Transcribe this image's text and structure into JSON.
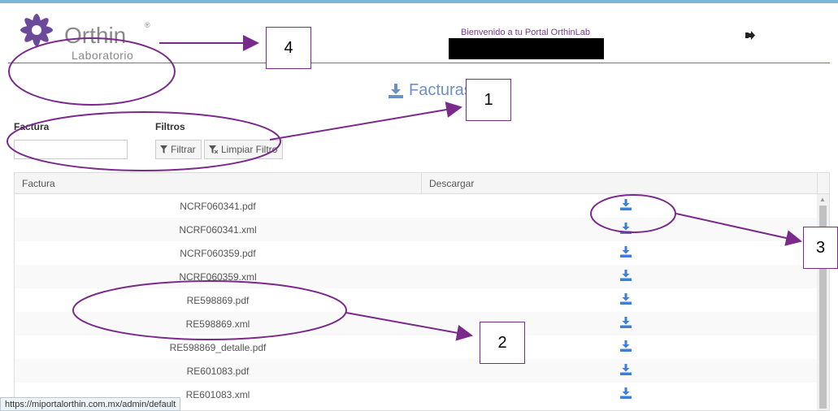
{
  "header": {
    "welcome_text": "Bienvenido a tu Portal OrthinLab",
    "logout_icon": "sign-out-icon",
    "logo_text": "Orthin",
    "logo_subtext": "Laboratorio",
    "logo_reg": "®"
  },
  "page": {
    "title": "Facturas",
    "title_icon": "download-icon"
  },
  "filters": {
    "factura_label": "Factura",
    "filtros_label": "Filtros",
    "factura_value": "",
    "filter_button": "Filtrar",
    "clear_button": "Limpiar Filtro"
  },
  "table": {
    "columns": [
      "Factura",
      "Descargar"
    ],
    "rows": [
      {
        "file": "NCRF060341.pdf"
      },
      {
        "file": "NCRF060341.xml"
      },
      {
        "file": "NCRF060359.pdf"
      },
      {
        "file": "NCRF060359.xml"
      },
      {
        "file": "RE598869.pdf"
      },
      {
        "file": "RE598869.xml"
      },
      {
        "file": "RE598869_detalle.pdf"
      },
      {
        "file": "RE601083.pdf"
      },
      {
        "file": "RE601083.xml"
      }
    ]
  },
  "status_bar": "https://miportalorthin.com.mx/admin/default",
  "annotations": [
    "1",
    "2",
    "3",
    "4"
  ],
  "colors": {
    "accent": "#6d8fc7",
    "annotation": "#7a2a8a",
    "download_icon": "#3d7fd6"
  }
}
